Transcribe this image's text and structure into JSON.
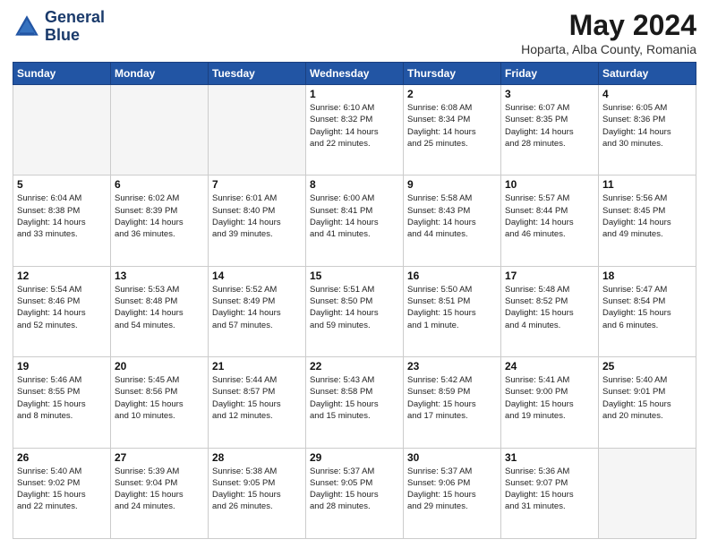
{
  "header": {
    "logo_line1": "General",
    "logo_line2": "Blue",
    "month": "May 2024",
    "location": "Hoparta, Alba County, Romania"
  },
  "weekdays": [
    "Sunday",
    "Monday",
    "Tuesday",
    "Wednesday",
    "Thursday",
    "Friday",
    "Saturday"
  ],
  "weeks": [
    [
      {
        "day": "",
        "info": ""
      },
      {
        "day": "",
        "info": ""
      },
      {
        "day": "",
        "info": ""
      },
      {
        "day": "1",
        "info": "Sunrise: 6:10 AM\nSunset: 8:32 PM\nDaylight: 14 hours\nand 22 minutes."
      },
      {
        "day": "2",
        "info": "Sunrise: 6:08 AM\nSunset: 8:34 PM\nDaylight: 14 hours\nand 25 minutes."
      },
      {
        "day": "3",
        "info": "Sunrise: 6:07 AM\nSunset: 8:35 PM\nDaylight: 14 hours\nand 28 minutes."
      },
      {
        "day": "4",
        "info": "Sunrise: 6:05 AM\nSunset: 8:36 PM\nDaylight: 14 hours\nand 30 minutes."
      }
    ],
    [
      {
        "day": "5",
        "info": "Sunrise: 6:04 AM\nSunset: 8:38 PM\nDaylight: 14 hours\nand 33 minutes."
      },
      {
        "day": "6",
        "info": "Sunrise: 6:02 AM\nSunset: 8:39 PM\nDaylight: 14 hours\nand 36 minutes."
      },
      {
        "day": "7",
        "info": "Sunrise: 6:01 AM\nSunset: 8:40 PM\nDaylight: 14 hours\nand 39 minutes."
      },
      {
        "day": "8",
        "info": "Sunrise: 6:00 AM\nSunset: 8:41 PM\nDaylight: 14 hours\nand 41 minutes."
      },
      {
        "day": "9",
        "info": "Sunrise: 5:58 AM\nSunset: 8:43 PM\nDaylight: 14 hours\nand 44 minutes."
      },
      {
        "day": "10",
        "info": "Sunrise: 5:57 AM\nSunset: 8:44 PM\nDaylight: 14 hours\nand 46 minutes."
      },
      {
        "day": "11",
        "info": "Sunrise: 5:56 AM\nSunset: 8:45 PM\nDaylight: 14 hours\nand 49 minutes."
      }
    ],
    [
      {
        "day": "12",
        "info": "Sunrise: 5:54 AM\nSunset: 8:46 PM\nDaylight: 14 hours\nand 52 minutes."
      },
      {
        "day": "13",
        "info": "Sunrise: 5:53 AM\nSunset: 8:48 PM\nDaylight: 14 hours\nand 54 minutes."
      },
      {
        "day": "14",
        "info": "Sunrise: 5:52 AM\nSunset: 8:49 PM\nDaylight: 14 hours\nand 57 minutes."
      },
      {
        "day": "15",
        "info": "Sunrise: 5:51 AM\nSunset: 8:50 PM\nDaylight: 14 hours\nand 59 minutes."
      },
      {
        "day": "16",
        "info": "Sunrise: 5:50 AM\nSunset: 8:51 PM\nDaylight: 15 hours\nand 1 minute."
      },
      {
        "day": "17",
        "info": "Sunrise: 5:48 AM\nSunset: 8:52 PM\nDaylight: 15 hours\nand 4 minutes."
      },
      {
        "day": "18",
        "info": "Sunrise: 5:47 AM\nSunset: 8:54 PM\nDaylight: 15 hours\nand 6 minutes."
      }
    ],
    [
      {
        "day": "19",
        "info": "Sunrise: 5:46 AM\nSunset: 8:55 PM\nDaylight: 15 hours\nand 8 minutes."
      },
      {
        "day": "20",
        "info": "Sunrise: 5:45 AM\nSunset: 8:56 PM\nDaylight: 15 hours\nand 10 minutes."
      },
      {
        "day": "21",
        "info": "Sunrise: 5:44 AM\nSunset: 8:57 PM\nDaylight: 15 hours\nand 12 minutes."
      },
      {
        "day": "22",
        "info": "Sunrise: 5:43 AM\nSunset: 8:58 PM\nDaylight: 15 hours\nand 15 minutes."
      },
      {
        "day": "23",
        "info": "Sunrise: 5:42 AM\nSunset: 8:59 PM\nDaylight: 15 hours\nand 17 minutes."
      },
      {
        "day": "24",
        "info": "Sunrise: 5:41 AM\nSunset: 9:00 PM\nDaylight: 15 hours\nand 19 minutes."
      },
      {
        "day": "25",
        "info": "Sunrise: 5:40 AM\nSunset: 9:01 PM\nDaylight: 15 hours\nand 20 minutes."
      }
    ],
    [
      {
        "day": "26",
        "info": "Sunrise: 5:40 AM\nSunset: 9:02 PM\nDaylight: 15 hours\nand 22 minutes."
      },
      {
        "day": "27",
        "info": "Sunrise: 5:39 AM\nSunset: 9:04 PM\nDaylight: 15 hours\nand 24 minutes."
      },
      {
        "day": "28",
        "info": "Sunrise: 5:38 AM\nSunset: 9:05 PM\nDaylight: 15 hours\nand 26 minutes."
      },
      {
        "day": "29",
        "info": "Sunrise: 5:37 AM\nSunset: 9:05 PM\nDaylight: 15 hours\nand 28 minutes."
      },
      {
        "day": "30",
        "info": "Sunrise: 5:37 AM\nSunset: 9:06 PM\nDaylight: 15 hours\nand 29 minutes."
      },
      {
        "day": "31",
        "info": "Sunrise: 5:36 AM\nSunset: 9:07 PM\nDaylight: 15 hours\nand 31 minutes."
      },
      {
        "day": "",
        "info": ""
      }
    ]
  ]
}
